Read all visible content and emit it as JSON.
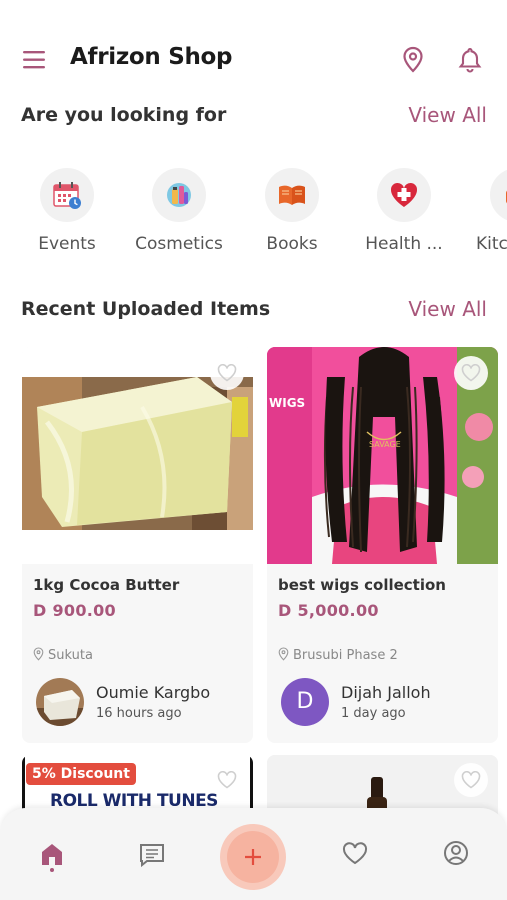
{
  "app": {
    "title": "Afrizon Shop"
  },
  "colors": {
    "accent": "#a8567a",
    "discount": "#e34d3e",
    "fab": "#f6b3a0"
  },
  "categories_section": {
    "title": "Are you looking for",
    "view_all": "View All",
    "items": [
      {
        "label": "Events",
        "icon": "calendar-icon"
      },
      {
        "label": "Cosmetics",
        "icon": "cosmetics-icon"
      },
      {
        "label": "Books",
        "icon": "books-icon"
      },
      {
        "label": "Health ...",
        "icon": "health-icon"
      },
      {
        "label": "Kitc",
        "icon": "kitchen-icon"
      }
    ]
  },
  "recent_section": {
    "title": "Recent Uploaded Items",
    "view_all": "View All",
    "items": [
      {
        "name": "1kg Cocoa Butter",
        "price": "D 900.00",
        "location": "Sukuta",
        "seller": "Oumie Kargbo",
        "time": "16 hours ago",
        "image": "cocoa-butter-photo"
      },
      {
        "name": "best wigs collection",
        "price": "D 5,000.00",
        "location": "Brusubi Phase 2",
        "seller": "Dijah Jalloh",
        "time": "1 day ago",
        "avatar_letter": "D",
        "image": "wigs-photo"
      },
      {
        "badge": "5% Discount",
        "banner_text": "ROLL WITH TUNES",
        "image": "roll-with-tunes-banner"
      },
      {
        "image": "bottle-photo"
      }
    ]
  },
  "bottom_nav": [
    {
      "name": "home",
      "icon": "home-icon"
    },
    {
      "name": "messages",
      "icon": "chat-icon"
    },
    {
      "name": "add",
      "icon": "plus-icon"
    },
    {
      "name": "favorites",
      "icon": "heart-icon"
    },
    {
      "name": "profile",
      "icon": "profile-icon"
    }
  ]
}
